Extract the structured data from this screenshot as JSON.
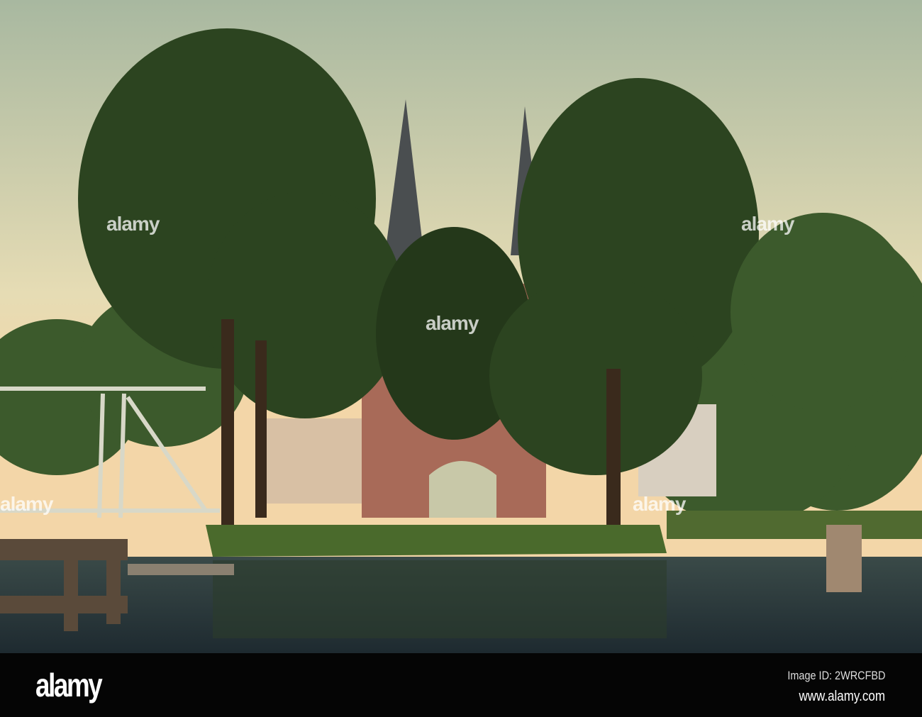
{
  "photo": {
    "subject": "Oostpoort gate with twin spires, trees and canal"
  },
  "watermark": {
    "text": "alamy"
  },
  "footer": {
    "logo": "alamy",
    "image_id": "Image ID: 2WRCFBD",
    "website": "www.alamy.com"
  },
  "colors": {
    "sky_top": "#a8b8a0",
    "sky_bottom": "#f0d8a8",
    "water": "#2a3a40",
    "brick": "#a86a58"
  }
}
